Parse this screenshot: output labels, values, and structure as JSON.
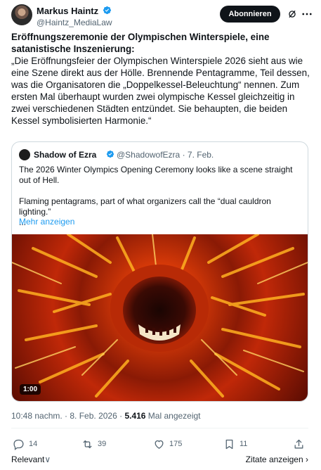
{
  "author": {
    "name": "Markus Haintz",
    "handle": "@Haintz_MediaLaw",
    "follow_label": "Abonnieren"
  },
  "tweet": {
    "title": "Eröffnungszeremonie der Olympischen Winterspiele, eine satanistische Inszenierung:",
    "body": "„Die Eröffnungsfeier der Olympischen Winterspiele 2026 sieht aus wie eine Szene direkt aus der Hölle.  Brennende Pentagramme, Teil dessen, was die Organisatoren die „Doppelkessel-Beleuchtung“ nennen. Zum ersten Mal überhaupt wurden zwei olympische Kessel gleichzeitig in zwei verschiedenen Städten entzündet. Sie behaupten, die beiden Kessel symbolisierten Harmonie.“"
  },
  "quote": {
    "name": "Shadow of Ezra",
    "meta": "@ShadowofEzra · 7. Feb.",
    "paragraph1": "The 2026 Winter Olympics Opening Ceremony looks like a scene straight out of Hell.",
    "paragraph2": "Flaming pentagrams, part of what organizers call the “dual cauldron lighting.”",
    "ellipsis": "...",
    "more_label": "Mehr anzeigen",
    "video_duration": "1:00"
  },
  "timestamp": {
    "time": "10:48 nachm. · 8. Feb. 2026 · ",
    "views_count": "5.416",
    "views_label": " Mal angezeigt"
  },
  "actions": {
    "replies": "14",
    "reposts": "39",
    "likes": "175",
    "bookmarks": "11"
  },
  "footer": {
    "relevant_label": "Relevant",
    "quotes_label": "Zitate anzeigen"
  },
  "colors": {
    "accent": "#1d9bf0",
    "text": "#0f1419",
    "muted": "#536471"
  }
}
